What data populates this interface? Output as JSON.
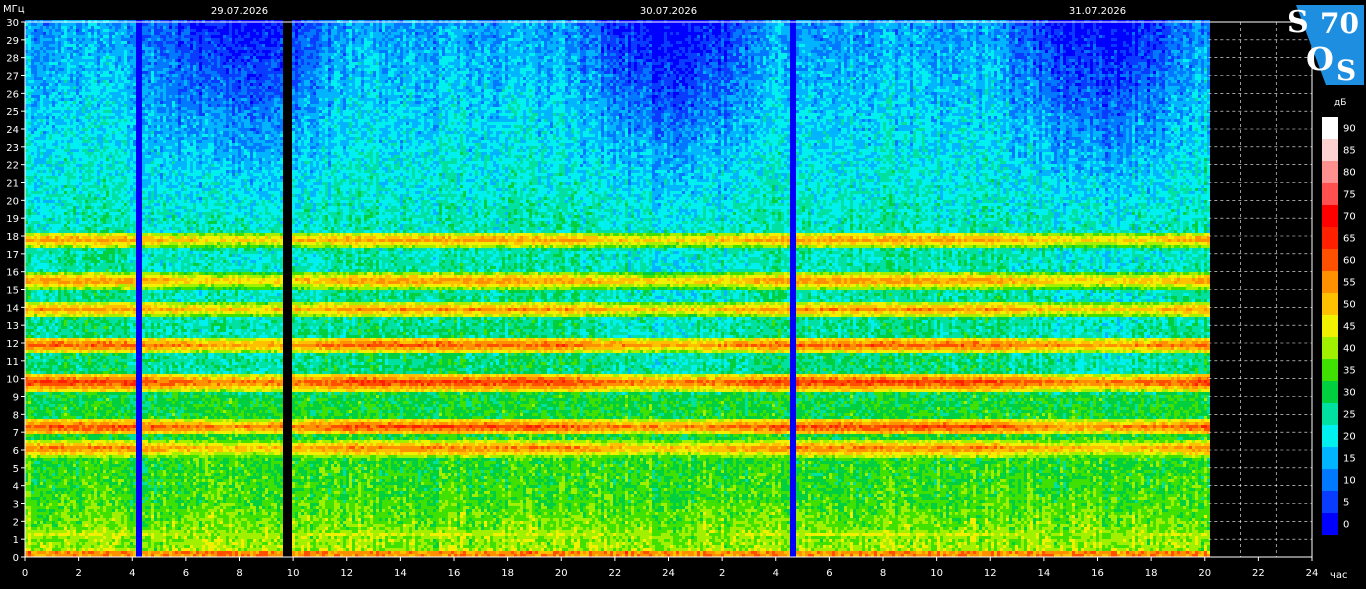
{
  "chart_data": {
    "type": "heatmap",
    "title": "",
    "ylabel": "МГц",
    "xlabel": "час",
    "colorbar_label": "дБ",
    "dates": [
      "29.07.2026",
      "30.07.2026",
      "31.07.2026"
    ],
    "ylim": [
      0,
      30
    ],
    "y_ticks": [
      0,
      1,
      2,
      3,
      4,
      5,
      6,
      7,
      8,
      9,
      10,
      11,
      12,
      13,
      14,
      15,
      16,
      17,
      18,
      19,
      20,
      21,
      22,
      23,
      24,
      25,
      26,
      27,
      28,
      29,
      30
    ],
    "x_tick_labels": [
      "0",
      "2",
      "4",
      "6",
      "8",
      "10",
      "12",
      "14",
      "16",
      "18",
      "20",
      "22",
      "24",
      "2",
      "4",
      "6",
      "8",
      "10",
      "12",
      "14",
      "16",
      "18",
      "20",
      "22",
      "24"
    ],
    "x_range_hours": [
      0,
      72
    ],
    "data_end_hour": 66.2,
    "gaps_hours": [
      {
        "start": 6.2,
        "end": 6.4,
        "kind": "low"
      },
      {
        "start": 14.4,
        "end": 14.9,
        "kind": "none"
      },
      {
        "start": 42.7,
        "end": 43.1,
        "kind": "low"
      }
    ],
    "colorbar_ticks": [
      0,
      5,
      10,
      15,
      20,
      25,
      30,
      35,
      40,
      45,
      50,
      55,
      60,
      65,
      70,
      75,
      80,
      85,
      90
    ],
    "colorbar_colors": [
      "#0000ff",
      "#0a3cff",
      "#0078ff",
      "#00b4ff",
      "#00f0f0",
      "#00e0a0",
      "#00d040",
      "#40e000",
      "#a0f000",
      "#f0f000",
      "#ffc000",
      "#ff9000",
      "#ff5000",
      "#ff2000",
      "#ff0000",
      "#ff5050",
      "#ff9090",
      "#ffd0d0",
      "#ffffff"
    ],
    "bands": [
      {
        "mhz": 1.2,
        "level": 44
      },
      {
        "mhz": 6.0,
        "level": 58
      },
      {
        "mhz": 7.2,
        "level": 62
      },
      {
        "mhz": 9.7,
        "level": 64
      },
      {
        "mhz": 11.8,
        "level": 60
      },
      {
        "mhz": 13.8,
        "level": 55
      },
      {
        "mhz": 15.4,
        "level": 56
      },
      {
        "mhz": 17.7,
        "level": 55
      }
    ],
    "logo": {
      "letters": [
        "S",
        "70",
        "O",
        "S"
      ],
      "color": "#1e8fe0"
    }
  }
}
